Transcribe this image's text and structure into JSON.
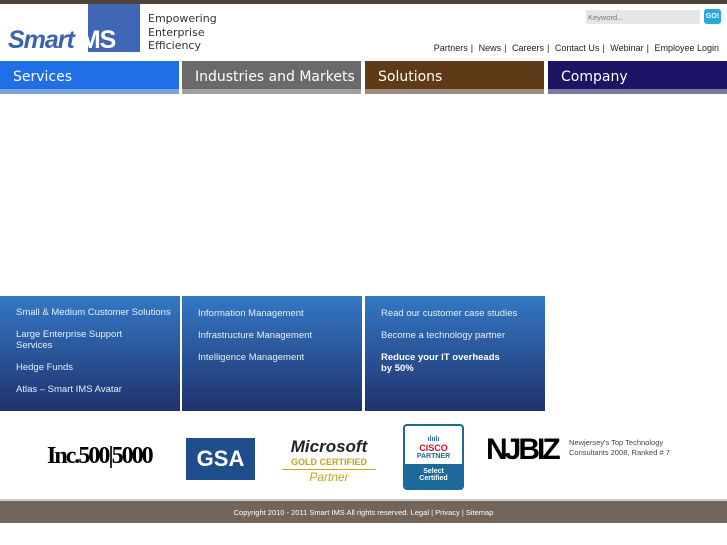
{
  "header": {
    "logo_text": "SmartIMS",
    "tagline": [
      "Empowering",
      "Enterprise",
      "Efficiency"
    ],
    "search_placeholder": "Keyword...",
    "go_label": "GO!",
    "links": [
      "Partners",
      "News",
      "Careers",
      "Contact Us",
      "Webinar",
      "Employee Login"
    ]
  },
  "nav": [
    {
      "label": "Services",
      "color": "#1f6fe6"
    },
    {
      "label": "Industries and Markets",
      "color": "#6a6a6a"
    },
    {
      "label": "Solutions",
      "color": "#5e3a17"
    },
    {
      "label": "Company",
      "color": "#1c1566"
    }
  ],
  "panels": [
    [
      "Small & Medium Customer Solutions",
      "Large Enterprise Support Services",
      "Hedge Funds",
      "Atlas – Smart IMS Avatar"
    ],
    [
      "Information Management",
      "Infrastructure Management",
      "Intelligence Management"
    ],
    [
      "Read our customer case studies",
      "Become a technology partner",
      "Reduce your IT overheads by 50%"
    ]
  ],
  "badges": {
    "inc": "Inc.500|5000",
    "gsa": "GSA",
    "ms1": "Microsoft",
    "ms2": "GOLD CERTIFIED",
    "ms3": "Partner",
    "cisco1": "CISCO",
    "cisco2": "PARTNER",
    "cisco3": "Select Certified",
    "njbiz": "NJBIZ",
    "njbiz_text": "Newjersey's Top Technology Consultants 2008, Ranked # 7"
  },
  "footer": {
    "copyright": "Copyright 2010 - 2011 Smart IMS All rights reserved.",
    "legal": "Legal",
    "privacy": "Privacy",
    "sitemap": "Sitemap"
  }
}
